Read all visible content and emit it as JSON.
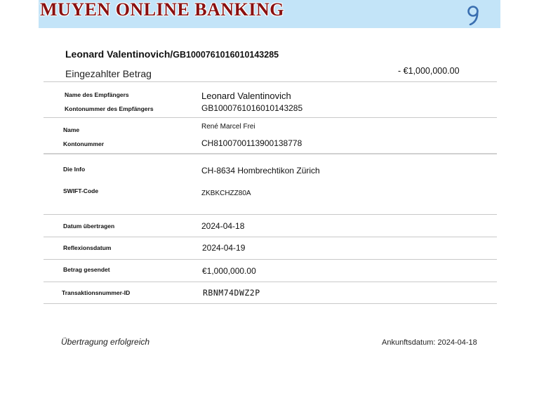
{
  "bank": {
    "title": "MUYEN ONLINE BANKING",
    "logo_icon": "bank-logo-icon",
    "banner_color": "#c3e4f8",
    "title_color": "#8a1010"
  },
  "header": {
    "account_holder": "Leonard Valentinovich",
    "separator": "/",
    "account_number": "GB1000761016010143285"
  },
  "summary": {
    "section_title": "Eingezahlter Betrag",
    "amount": "- €1,000,000.00"
  },
  "details": {
    "recipient_name_label": "Name des Empfängers",
    "recipient_name": "Leonard Valentinovich",
    "recipient_account_label": "Kontonummer des Empfängers",
    "recipient_account": "GB1000761016010143285",
    "name_label": "Name",
    "name": "René Marcel Frei",
    "account_label": "Kontonummer",
    "account": "CH8100700113900138778",
    "info_label": "Die Info",
    "info": "CH-8634 Hombrechtikon Zürich",
    "swift_label": "SWIFT-Code",
    "swift": "ZKBKCHZZ80A",
    "date_transferred_label": "Datum übertragen",
    "date_transferred": "2024-04-18",
    "reflection_date_label": "Reflexionsdatum",
    "reflection_date": "2024-04-19",
    "amount_sent_label": "Betrag gesendet",
    "amount_sent": "€1,000,000.00",
    "transaction_id_label": "Transaktionsnummer-ID",
    "transaction_id": "RBNM74DWZ2P"
  },
  "footer": {
    "status": "Übertragung erfolgreich",
    "arrival_label": "Ankunftsdatum",
    "arrival_separator": ":",
    "arrival_date": "2024-04-18"
  }
}
